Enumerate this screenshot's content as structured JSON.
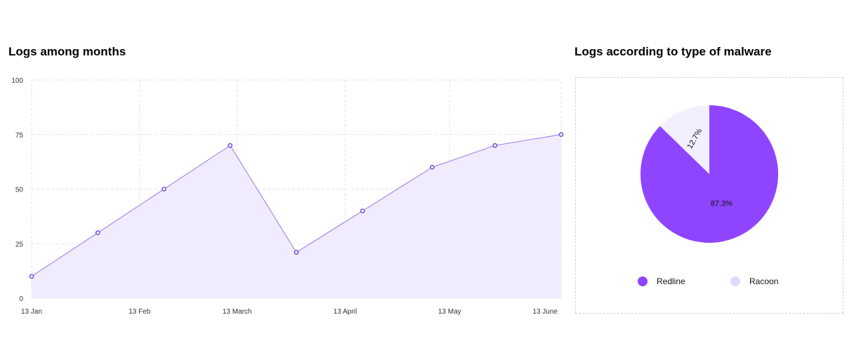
{
  "area_chart": {
    "title": "Logs among months"
  },
  "pie_chart": {
    "title": "Logs according to type of malware",
    "legend": [
      {
        "label": "Redline",
        "color": "#8f45ff"
      },
      {
        "label": "Racoon",
        "color": "#e4d8fb"
      }
    ]
  },
  "colors": {
    "line": "#a98be6",
    "point": "#7b52d6",
    "fill": "#f1ecfd",
    "grid": "#e2e2e2",
    "redline": "#8f45ff",
    "racoon": "#f3efff"
  },
  "chart_data": [
    {
      "type": "area",
      "title": "Logs among months",
      "x_dates": [
        "2021-01-13",
        "2021-02-01",
        "2021-02-20",
        "2021-03-11",
        "2021-03-30",
        "2021-04-18",
        "2021-05-08",
        "2021-05-26",
        "2021-06-14"
      ],
      "values": [
        10,
        30,
        50,
        70,
        21,
        40,
        60,
        70,
        75
      ],
      "xticks": [
        "13 Jan",
        "13 Feb",
        "13 March",
        "13 April",
        "13 May",
        "13 June"
      ],
      "xtick_dates": [
        "2021-01-13",
        "2021-02-13",
        "2021-03-13",
        "2021-04-13",
        "2021-05-13",
        "2021-06-13"
      ],
      "yticks": [
        0,
        25,
        50,
        75,
        100
      ],
      "ylim": [
        0,
        100
      ],
      "grid": true
    },
    {
      "type": "pie",
      "title": "Logs according to type of malware",
      "labels": [
        "Redline",
        "Racoon"
      ],
      "values": [
        87.3,
        12.7
      ],
      "value_labels": [
        "87.3%",
        "12.7%"
      ],
      "legend_position": "bottom"
    }
  ]
}
